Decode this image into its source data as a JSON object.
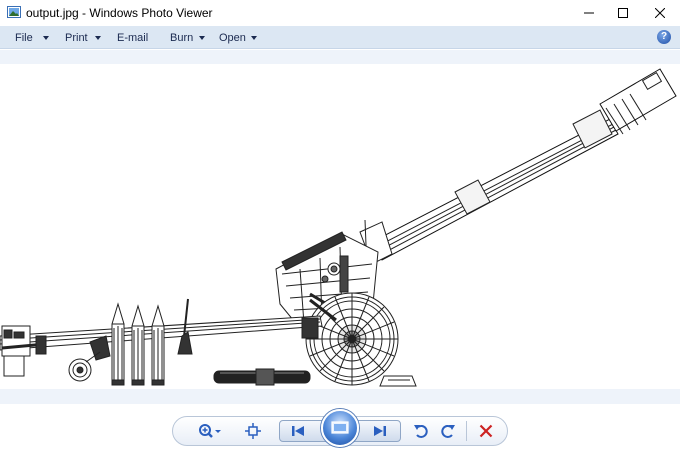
{
  "window": {
    "title": "output.jpg - Windows Photo Viewer"
  },
  "menu": {
    "file": "File",
    "print": "Print",
    "email": "E-mail",
    "burn": "Burn",
    "open": "Open"
  },
  "help": {
    "label": "?"
  },
  "image": {
    "subject": "wireframe howitzer artillery gun with shells"
  },
  "toolbar": {
    "buttons": [
      "zoom-icon",
      "actual-size-icon",
      "previous-icon",
      "slideshow-icon",
      "next-icon",
      "rotate-counterclockwise-icon",
      "rotate-clockwise-icon",
      "delete-icon"
    ]
  },
  "colors": {
    "menubar_bg": "#dce7f3",
    "accent_blue": "#2a5fbf",
    "delete_red": "#cc2222"
  }
}
